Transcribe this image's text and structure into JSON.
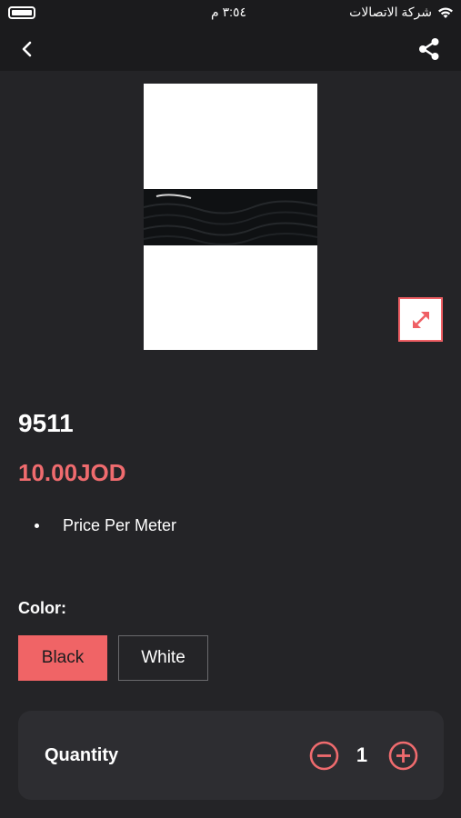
{
  "status_bar": {
    "time": "٣:٥٤ م",
    "carrier": "شركة الاتصالات"
  },
  "nav": {
    "back_icon": "chevron-left-icon",
    "share_icon": "share-icon"
  },
  "product": {
    "title": "9511",
    "price": "10.00JOD",
    "features": [
      "Price Per Meter"
    ],
    "expand_icon": "expand-arrows-icon"
  },
  "color": {
    "label": "Color:",
    "options": [
      {
        "label": "Black",
        "selected": true
      },
      {
        "label": "White",
        "selected": false
      }
    ]
  },
  "quantity": {
    "label": "Quantity",
    "value": "1",
    "decrement_icon": "minus-circle-icon",
    "increment_icon": "plus-circle-icon"
  },
  "colors": {
    "accent": "#ef6b6e",
    "background": "#242427",
    "panel": "#2d2d31"
  }
}
